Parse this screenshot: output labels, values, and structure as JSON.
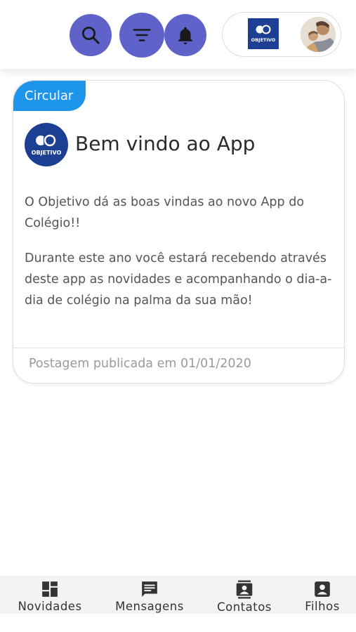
{
  "header": {
    "icons": [
      "search-icon",
      "filter-icon",
      "bell-icon"
    ],
    "school_logo_text": "OBJETIVO",
    "accent_color": "#5f63c9"
  },
  "post": {
    "tag": "Circular",
    "tag_color": "#1d95ea",
    "logo_text": "OBJETIVO",
    "title": "Bem vindo ao App",
    "paragraph1": "O Objetivo dá as boas vindas ao novo App do Colégio!!",
    "paragraph2": "Durante este ano você estará recebendo através deste app as novidades e acompanhando o dia-a-dia de colégio na palma da sua mão!",
    "footer": "Postagem publicada em 01/01/2020"
  },
  "nav": {
    "items": [
      {
        "label": "Novidades",
        "icon": "dashboard-icon"
      },
      {
        "label": "Mensagens",
        "icon": "message-icon"
      },
      {
        "label": "Contatos",
        "icon": "contacts-icon"
      },
      {
        "label": "Filhos",
        "icon": "person-icon"
      }
    ]
  }
}
